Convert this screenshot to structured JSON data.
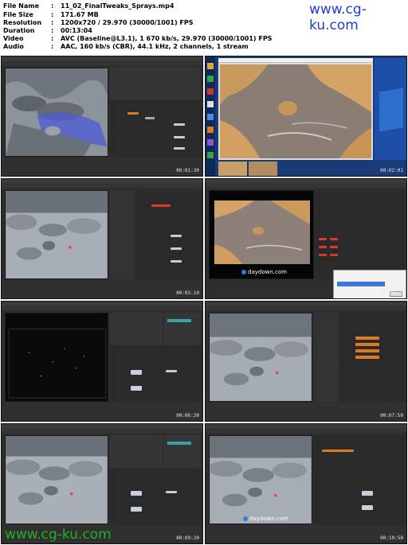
{
  "info": {
    "file_name_label": "File Name",
    "file_name": "11_02_FinalTweaks_Sprays.mp4",
    "file_size_label": "File Size",
    "file_size": "171.67 MB",
    "resolution_label": "Resolution",
    "resolution": "1200x720 / 29.970 (30000/1001) FPS",
    "duration_label": "Duration",
    "duration": "00:13:04",
    "video_label": "Video",
    "video": "AVC (Baseline@L3.1), 1 670 kb/s, 29.970 (30000/1001) FPS",
    "audio_label": "Audio",
    "audio": "AAC, 160 kb/s (CBR), 44.1 kHz, 2 channels, 1 stream"
  },
  "separator": ":",
  "watermark_top": "www.cg-ku.com",
  "watermark_bottom": "www.cg-ku.com",
  "daydown_label": "daydown.com",
  "thumbnails": [
    {
      "timecode": "00:01:30"
    },
    {
      "timecode": "00:02:01"
    },
    {
      "timecode": "00:03:10"
    },
    {
      "timecode": "00:04:50"
    },
    {
      "timecode": "00:06:20"
    },
    {
      "timecode": "00:07:50"
    },
    {
      "timecode": "00:09:20"
    },
    {
      "timecode": "00:10:50"
    }
  ],
  "colors": {
    "watermark_blue": "#1f3fcf",
    "watermark_green": "#1fb31f",
    "daydown_blue": "#2b7de0",
    "ui_dark": "#2e2e2e",
    "node_orange": "#e07a22",
    "node_red": "#d93a2a"
  }
}
